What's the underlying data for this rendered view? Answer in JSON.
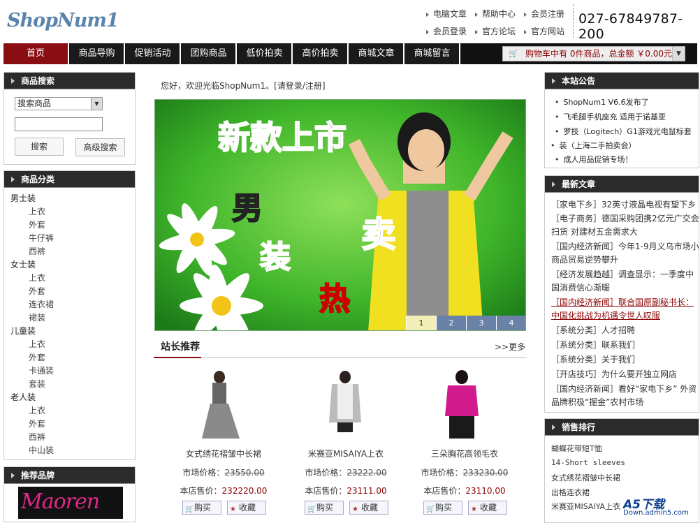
{
  "header": {
    "logo": "ShopNum1",
    "links_row1": [
      "电脑文章",
      "帮助中心",
      "会员注册"
    ],
    "links_row2": [
      "会员登录",
      "官方论坛",
      "官方网站"
    ],
    "phone": "027-67849787-200"
  },
  "nav": {
    "items": [
      "首页",
      "商品导购",
      "促销活动",
      "团购商品",
      "低价拍卖",
      "高价拍卖",
      "商城文章",
      "商城留言"
    ],
    "active": "首页"
  },
  "cart": {
    "text": "购物车中有 0件商品，总金额 ￥0.00元"
  },
  "search": {
    "title": "商品搜索",
    "select_value": "搜索商品",
    "search_button": "搜索",
    "advanced_button": "高级搜索"
  },
  "categories": {
    "title": "商品分类",
    "groups": [
      {
        "name": "男士装",
        "items": [
          "上衣",
          "外套",
          "牛仔裤",
          "西裤"
        ]
      },
      {
        "name": "女士装",
        "items": [
          "上衣",
          "外套",
          "连衣裙",
          "裙装"
        ]
      },
      {
        "name": "儿童装",
        "items": [
          "上衣",
          "外套",
          "卡通装",
          "套装"
        ]
      },
      {
        "name": "老人装",
        "items": [
          "上衣",
          "外套",
          "西裤",
          "中山装"
        ]
      }
    ]
  },
  "brands": {
    "title": "推荐品牌",
    "logo_text": "Maoren"
  },
  "welcome": {
    "text": "您好，欢迎光临ShopNum1。",
    "login_link": "[请登录/注册]"
  },
  "banner": {
    "headline": "新款上市",
    "chars": [
      "男",
      "装",
      "热",
      "卖"
    ],
    "pages": [
      "1",
      "2",
      "3",
      "4"
    ],
    "active_page": "1"
  },
  "recommend": {
    "title": "站长推荐",
    "more": ">>更多",
    "market_label": "市场价格：",
    "price_label": "本店售价：",
    "buy_label": "购买",
    "fav_label": "收藏",
    "products": [
      {
        "name": "女式绣花褶皱中长裙",
        "market_price": "23550.00",
        "price": "232220.00"
      },
      {
        "name": "米赛亚MISAIYA上衣",
        "market_price": "23222.00",
        "price": "23111.00"
      },
      {
        "name": "三朵胸花高领毛衣",
        "market_price": "233230.00",
        "price": "23110.00"
      }
    ]
  },
  "notice": {
    "title": "本站公告",
    "items": [
      "ShopNum1 V6.6发布了",
      "飞毛腿手机座充 适用于诺基亚",
      "罗技（Logitech）G1游戏光电鼠标套",
      "装（上海二手拍卖会）",
      "成人用品促销专场！"
    ]
  },
  "articles": {
    "title": "最新文章",
    "items": [
      "［家电下乡］32英寸液晶电视有望下乡",
      "［电子商务］德国采购团携2亿元广交会扫货 对建材五金需求大",
      "［国内经济新闻］今年1-9月义乌市场小商品贸易逆势攀升",
      "［经济发展趋越］调查显示：一季度中国消费信心渐暖",
      "［国内经济新闻］联合国原副秘书长：中国化挑战为机遇令世人叹服",
      "［系统分类］人才招聘",
      "［系统分类］联系我们",
      "［系统分类］关于我们",
      "［开店技巧］为什么要开独立网店",
      "［国内经济新闻］看好“家电下乡” 外资品牌积极“掘金”农村市场"
    ]
  },
  "sales": {
    "title": "销售排行",
    "items": [
      "蝴蝶花带短T恤",
      "14-Short sleeves",
      "女式绣花褶皱中长裙",
      "出格连衣裙",
      "米赛亚MISAIYA上衣"
    ]
  },
  "watermark": {
    "brand": "A5下载",
    "url": "Down.admin5.com"
  }
}
